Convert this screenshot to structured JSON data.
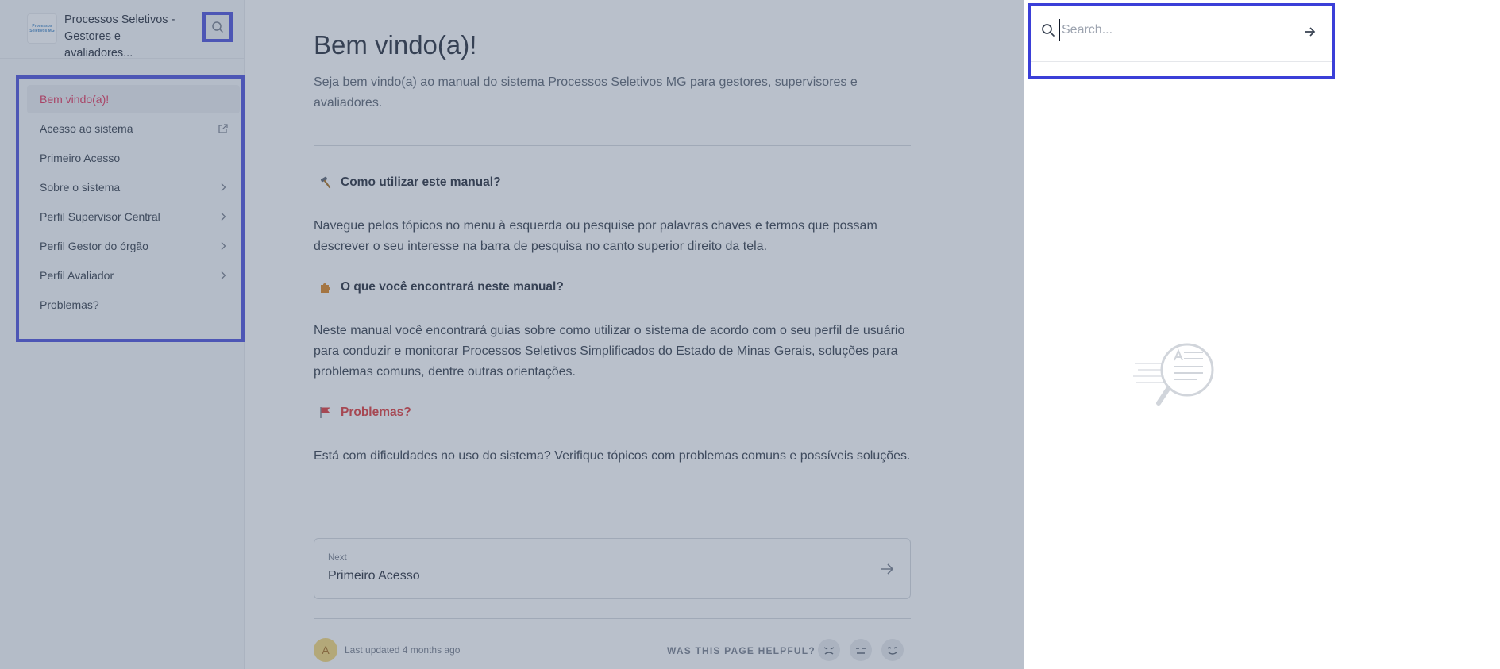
{
  "site": {
    "logo_text": "Processos Seletivos MG",
    "title": "Processos Seletivos - Gestores e avaliadores..."
  },
  "sidebar": {
    "items": [
      {
        "label": "Bem vindo(a)!",
        "active": true,
        "trail": "none"
      },
      {
        "label": "Acesso ao sistema",
        "trail": "external-link-icon"
      },
      {
        "label": "Primeiro Acesso",
        "trail": "none"
      },
      {
        "label": "Sobre o sistema",
        "trail": "chevron-right-icon"
      },
      {
        "label": "Perfil Supervisor Central",
        "trail": "chevron-right-icon"
      },
      {
        "label": "Perfil Gestor do órgão",
        "trail": "chevron-right-icon"
      },
      {
        "label": "Perfil Avaliador",
        "trail": "chevron-right-icon"
      },
      {
        "label": "Problemas?",
        "trail": "none"
      }
    ]
  },
  "page": {
    "title": "Bem vindo(a)!",
    "lead": "Seja bem vindo(a) ao manual do sistema Processos Seletivos MG para gestores, supervisores e avaliadores.",
    "sections": [
      {
        "icon": "hammer-icon",
        "heading": "Como utilizar este manual?",
        "text": "Navegue pelos tópicos no menu à esquerda ou pesquise por palavras chaves e termos que possam descrever o seu interesse na barra de pesquisa no canto superior direito da tela."
      },
      {
        "icon": "puzzle-icon",
        "heading": "O que você encontrará neste manual?",
        "text": "Neste manual você encontrará guias sobre como utilizar o sistema de acordo com o seu perfil de usuário para conduzir e monitorar Processos Seletivos Simplificados do Estado de Minas Gerais, soluções para problemas comuns, dentre outras orientações."
      },
      {
        "icon": "flag-icon",
        "heading": "Problemas?",
        "text": "Está com dificuldades no uso do sistema? Verifique tópicos com problemas comuns e possíveis soluções."
      }
    ],
    "next": {
      "label": "Next",
      "title": "Primeiro Acesso"
    },
    "footer": {
      "avatar_letter": "A",
      "updated": "Last updated 4 months ago",
      "helpful": "WAS THIS PAGE HELPFUL?"
    }
  },
  "search": {
    "placeholder": "Search...",
    "value": ""
  },
  "colors": {
    "accent": "#3b3fd8",
    "active_link": "#e11d48",
    "overlay": "rgba(100,116,139,0.45)"
  }
}
